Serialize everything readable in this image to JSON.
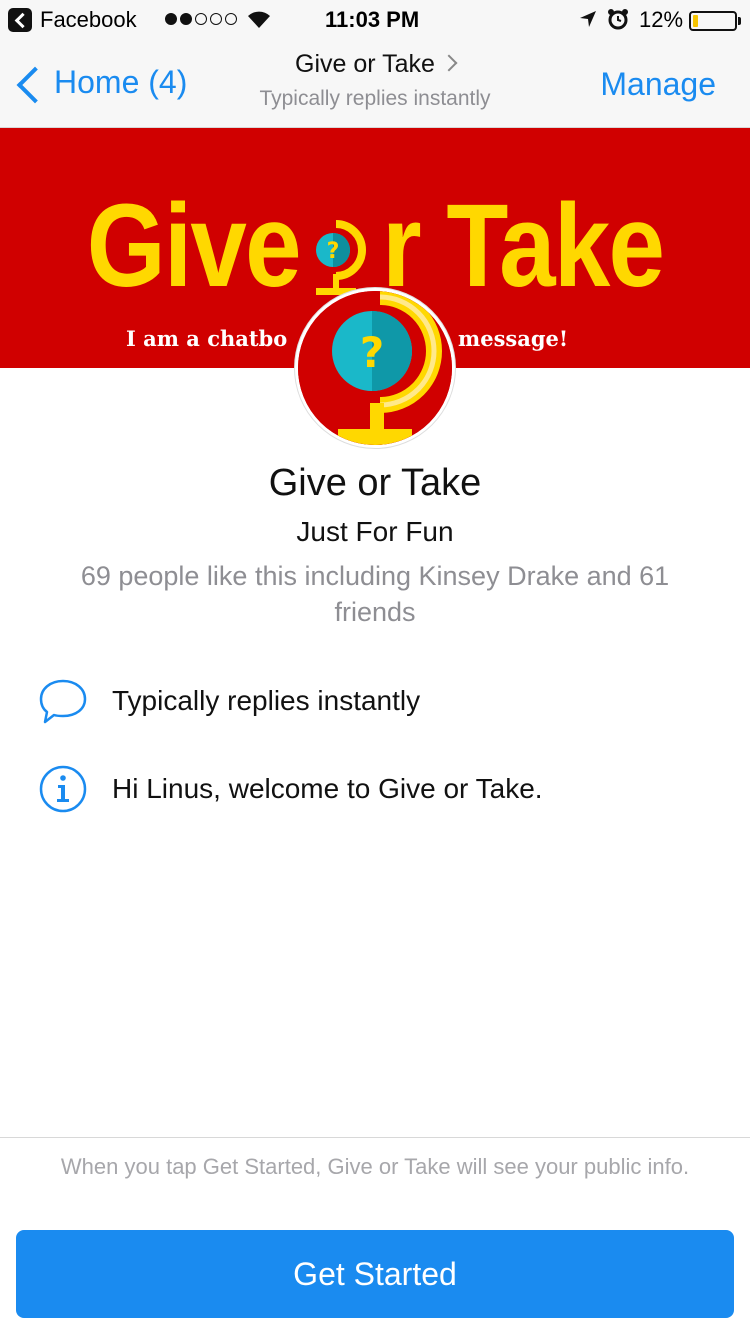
{
  "status_bar": {
    "app_name": "Facebook",
    "time": "11:03 PM",
    "battery": "12%",
    "battery_level": 0.12,
    "signal_bars": 2,
    "signal_total": 5
  },
  "nav": {
    "back_label": "Home (4)",
    "title": "Give or Take",
    "subtitle": "Typically replies instantly",
    "manage_label": "Manage"
  },
  "banner": {
    "title_left": "Give ",
    "title_right": "r Take",
    "tagline_left": "I am a chatbo",
    "tagline_right": "message!"
  },
  "profile": {
    "name": "Give or Take",
    "category": "Just For Fun",
    "likes": "69 people like this including Kinsey Drake and 61 friends"
  },
  "info": {
    "response_time": "Typically replies instantly",
    "greeting": "Hi Linus, welcome to Give or Take."
  },
  "footer": {
    "disclaimer": "When you tap Get Started, Give or Take will see your public info.",
    "cta_label": "Get Started"
  },
  "colors": {
    "accent": "#1a8bf0",
    "banner_red": "#d00000",
    "banner_yellow": "#ffd800",
    "globe_teal": "#1ab8c9"
  },
  "icons": {
    "back": "chevron-left-icon",
    "nav_title": "chevron-right-icon",
    "response": "speech-bubble-icon",
    "greeting": "info-icon",
    "logo": "globe-question-icon"
  }
}
